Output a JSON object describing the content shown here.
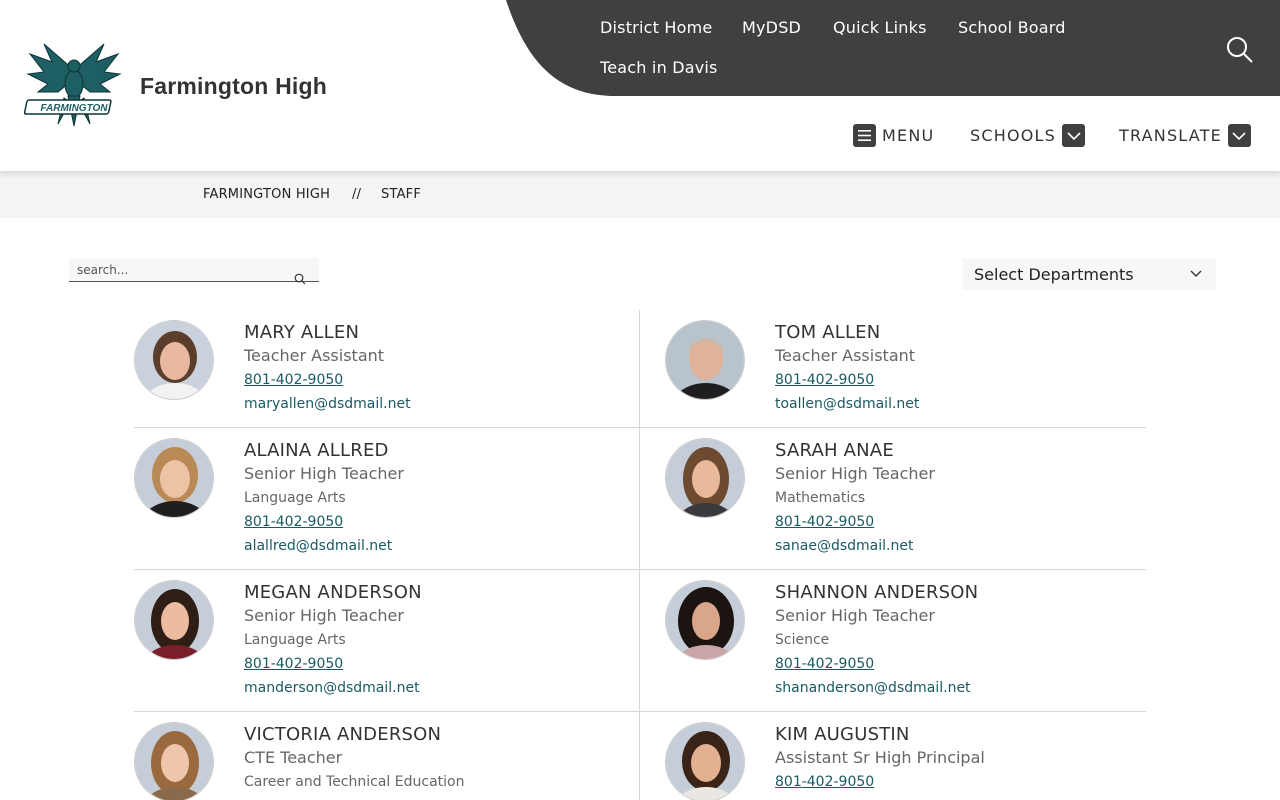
{
  "header": {
    "school_name": "Farmington High",
    "logo_text": "FARMINGTON",
    "top_nav": [
      "District Home",
      "MyDSD",
      "Quick Links",
      "School Board",
      "Teach in Davis"
    ],
    "main_nav": {
      "menu": "MENU",
      "schools": "SCHOOLS",
      "translate": "TRANSLATE"
    }
  },
  "breadcrumb": {
    "home": "FARMINGTON HIGH",
    "separator": "//",
    "current": "STAFF"
  },
  "search": {
    "placeholder": "search..."
  },
  "department_filter": {
    "selected": "Select Departments"
  },
  "colors": {
    "dark": "#404041",
    "link": "#1a5a63",
    "logo_teal": "#1d5f63"
  },
  "staff": [
    {
      "name": "MARY ALLEN",
      "title": "Teacher Assistant",
      "department": "",
      "phone": "801-402-9050",
      "email": "maryallen@dsdmail.net"
    },
    {
      "name": "TOM ALLEN",
      "title": "Teacher Assistant",
      "department": "",
      "phone": "801-402-9050",
      "email": "toallen@dsdmail.net"
    },
    {
      "name": "ALAINA ALLRED",
      "title": "Senior High Teacher",
      "department": "Language Arts",
      "phone": "801-402-9050",
      "email": "alallred@dsdmail.net"
    },
    {
      "name": "SARAH ANAE",
      "title": "Senior High Teacher",
      "department": "Mathematics",
      "phone": "801-402-9050",
      "email": "sanae@dsdmail.net"
    },
    {
      "name": "MEGAN ANDERSON",
      "title": "Senior High Teacher",
      "department": "Language Arts",
      "phone": "801-402-9050",
      "email": "manderson@dsdmail.net"
    },
    {
      "name": "SHANNON ANDERSON",
      "title": "Senior High Teacher",
      "department": "Science",
      "phone": "801-402-9050",
      "email": "shananderson@dsdmail.net"
    },
    {
      "name": "VICTORIA ANDERSON",
      "title": "CTE Teacher",
      "department": "Career and Technical Education",
      "phone": "",
      "email": ""
    },
    {
      "name": "KIM AUGUSTIN",
      "title": "Assistant Sr High Principal",
      "department": "",
      "phone": "801-402-9050",
      "email": ""
    }
  ]
}
